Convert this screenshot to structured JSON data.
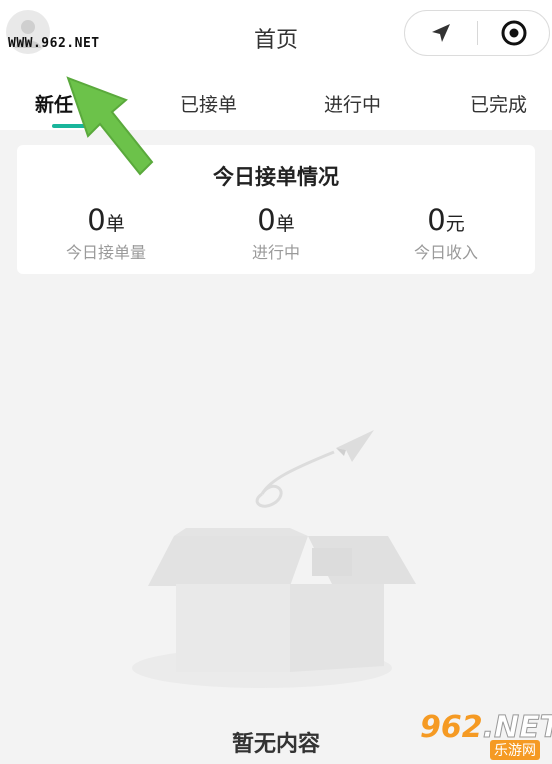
{
  "header": {
    "title": "首页",
    "watermark": "WWW.962.NET"
  },
  "tabs": [
    {
      "label": "新任",
      "active": true
    },
    {
      "label": "已接单",
      "active": false
    },
    {
      "label": "进行中",
      "active": false
    },
    {
      "label": "已完成",
      "active": false
    }
  ],
  "summary": {
    "title": "今日接单情况",
    "stats": [
      {
        "value": "0",
        "unit": "单",
        "label": "今日接单量"
      },
      {
        "value": "0",
        "unit": "单",
        "label": "进行中"
      },
      {
        "value": "0",
        "unit": "元",
        "label": "今日收入"
      }
    ]
  },
  "empty": {
    "text": "暂无内容"
  },
  "bottom_watermark": {
    "big": "962",
    "big_suffix": ".NET",
    "small": "乐游网"
  },
  "colors": {
    "accent": "#19b59b",
    "arrow": "#6cc24a",
    "background": "#f3f3f3"
  },
  "icons": [
    "avatar-icon",
    "navigation-icon",
    "record-icon",
    "paper-plane-icon",
    "empty-box-icon"
  ]
}
